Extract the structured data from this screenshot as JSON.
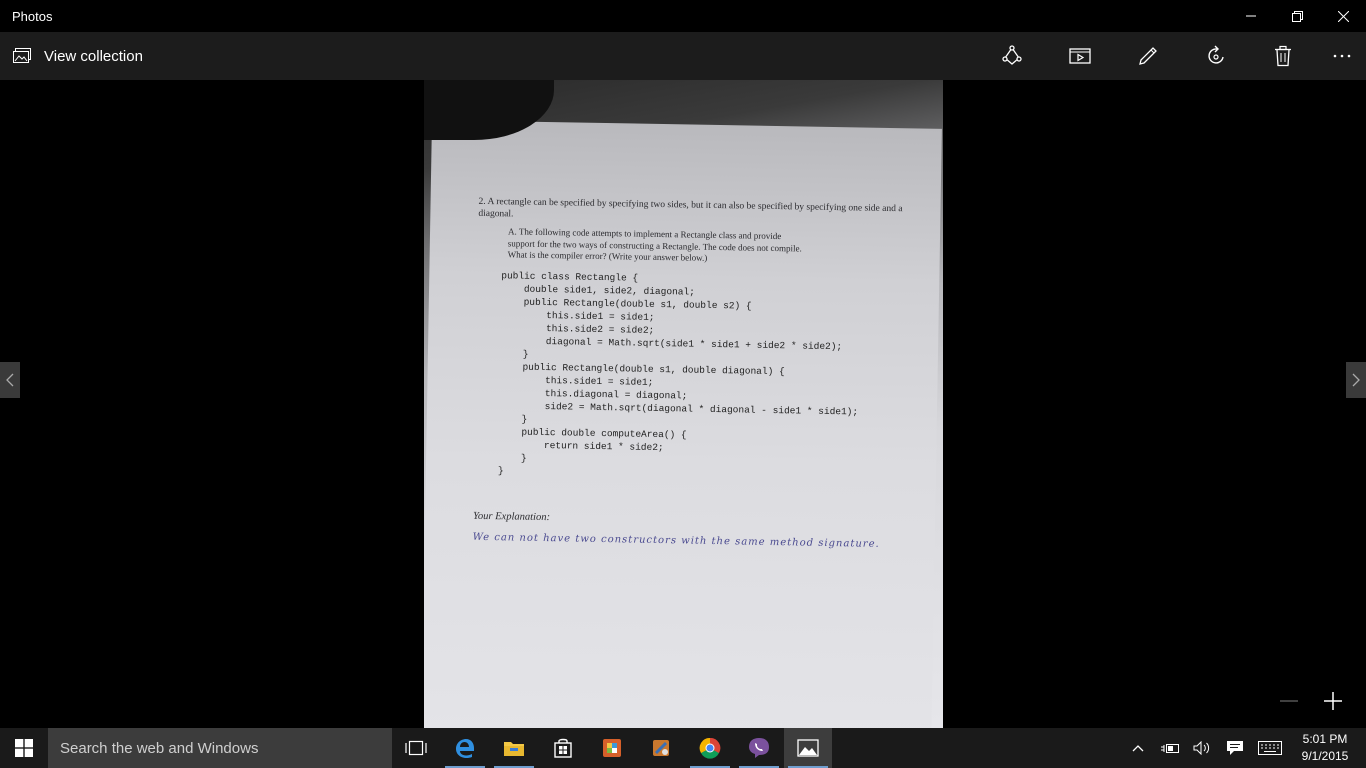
{
  "app": {
    "title": "Photos"
  },
  "toolbar": {
    "view_collection": "View collection"
  },
  "document": {
    "question": "2. A rectangle can be specified by specifying two sides, but it can also be specified by specifying one side and a diagonal.",
    "part_a": "A. The following code attempts to implement a Rectangle class and provide support for the two ways of constructing a Rectangle. The code does not compile. What is the compiler error? (Write your answer below.)",
    "code": "public class Rectangle {\n    double side1, side2, diagonal;\n    public Rectangle(double s1, double s2) {\n        this.side1 = side1;\n        this.side2 = side2;\n        diagonal = Math.sqrt(side1 * side1 + side2 * side2);\n    }\n    public Rectangle(double s1, double diagonal) {\n        this.side1 = side1;\n        this.diagonal = diagonal;\n        side2 = Math.sqrt(diagonal * diagonal - side1 * side1);\n    }\n    public double computeArea() {\n        return side1 * side2;\n    }\n}",
    "explanation_label": "Your Explanation:",
    "handwritten_answer": "We can not have two constructors with the same method signature."
  },
  "taskbar": {
    "search_placeholder": "Search the web and Windows",
    "time": "5:01 PM",
    "date": "9/1/2015"
  },
  "colors": {
    "taskbar_bg": "#1a1a1a",
    "toolbar_bg": "#1c1c1c",
    "accent": "#6f9ecf"
  }
}
